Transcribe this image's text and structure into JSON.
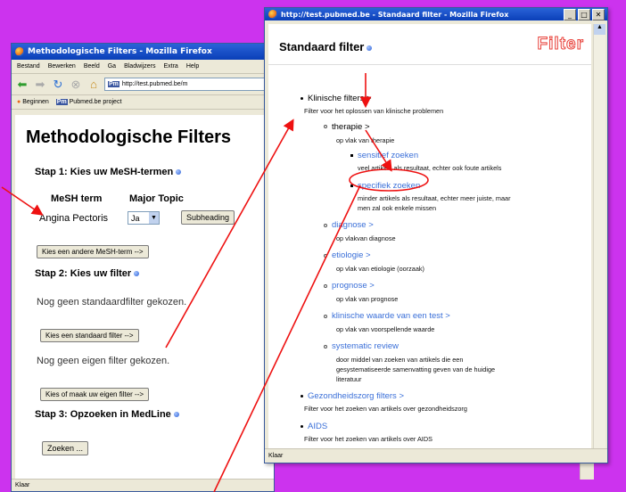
{
  "left_window": {
    "title": "Methodologische Filters - Mozilla Firefox",
    "menu": [
      "Bestand",
      "Bewerken",
      "Beeld",
      "Ga",
      "Bladwijzers",
      "Extra",
      "Help"
    ],
    "url": "http://test.pubmed.be/m",
    "bookmarks": [
      "Beginnen",
      "Pubmed.be project"
    ],
    "heading": "Methodologische Filters",
    "step1": "Stap 1: Kies uw MeSH-termen",
    "col_mesh": "MeSH term",
    "col_major": "Major Topic",
    "mesh_value": "Angina Pectoris",
    "major_value": "Ja",
    "subheading_btn": "Subheading",
    "other_mesh_btn": "Kies een andere MeSH-term -->",
    "step2": "Stap 2: Kies uw filter",
    "no_std_filter": "Nog geen standaardfilter gekozen.",
    "std_filter_btn": "Kies een standaard filter -->",
    "no_own_filter": "Nog geen eigen filter gekozen.",
    "own_filter_btn": "Kies of maak uw eigen filter -->",
    "step3": "Stap 3: Opzoeken in MedLine",
    "search_btn": "Zoeken ...",
    "status": "Klaar"
  },
  "right_window": {
    "title": "http://test.pubmed.be - Standaard filter - Mozilla Firefox",
    "heading": "Standaard filter",
    "logo": "Filter",
    "status": "Klaar",
    "items": {
      "klinische": "Klinische filters >",
      "klinische_desc": "Filter voor het oplossen van klinische problemen",
      "therapie": "therapie >",
      "therapie_desc": "op vlak van therapie",
      "sensitief": "sensitief zoeken",
      "sensitief_desc": "veel artikels als resultaat, echter ook foute artikels",
      "specifiek": "specifiek zoeken",
      "specifiek_desc1": "minder artikels als resultaat, echter meer juiste, maar",
      "specifiek_desc2": "men zal ook enkele missen",
      "diagnose": "diagnose >",
      "diagnose_desc": "op vlakvan diagnose",
      "etiologie": "etiologie >",
      "etiologie_desc": "op vlak van etiologie (oorzaak)",
      "prognose": "prognose >",
      "prognose_desc": "op vlak van prognose",
      "klinische_waarde": "klinische waarde van een test >",
      "klinische_waarde_desc": "op vlak van voorspellende waarde",
      "systematic": "systematic review",
      "systematic_desc1": "door middel van zoeken van artikels die een",
      "systematic_desc2": "gesystematiseerde samenvatting geven van de huidige",
      "systematic_desc3": "literatuur",
      "gezondheidszorg": "Gezondheidszorg filters >",
      "gezondheidszorg_desc": "Filter voor het zoeken van artikels over gezondheidszorg",
      "aids": "AIDS",
      "aids_desc": "Filter voor het zoeken van artikels over AIDS"
    }
  },
  "colors": {
    "background": "#cc33ee",
    "arrow": "#ee1111",
    "link": "#3a6fd8",
    "logo": "#e8413a"
  }
}
